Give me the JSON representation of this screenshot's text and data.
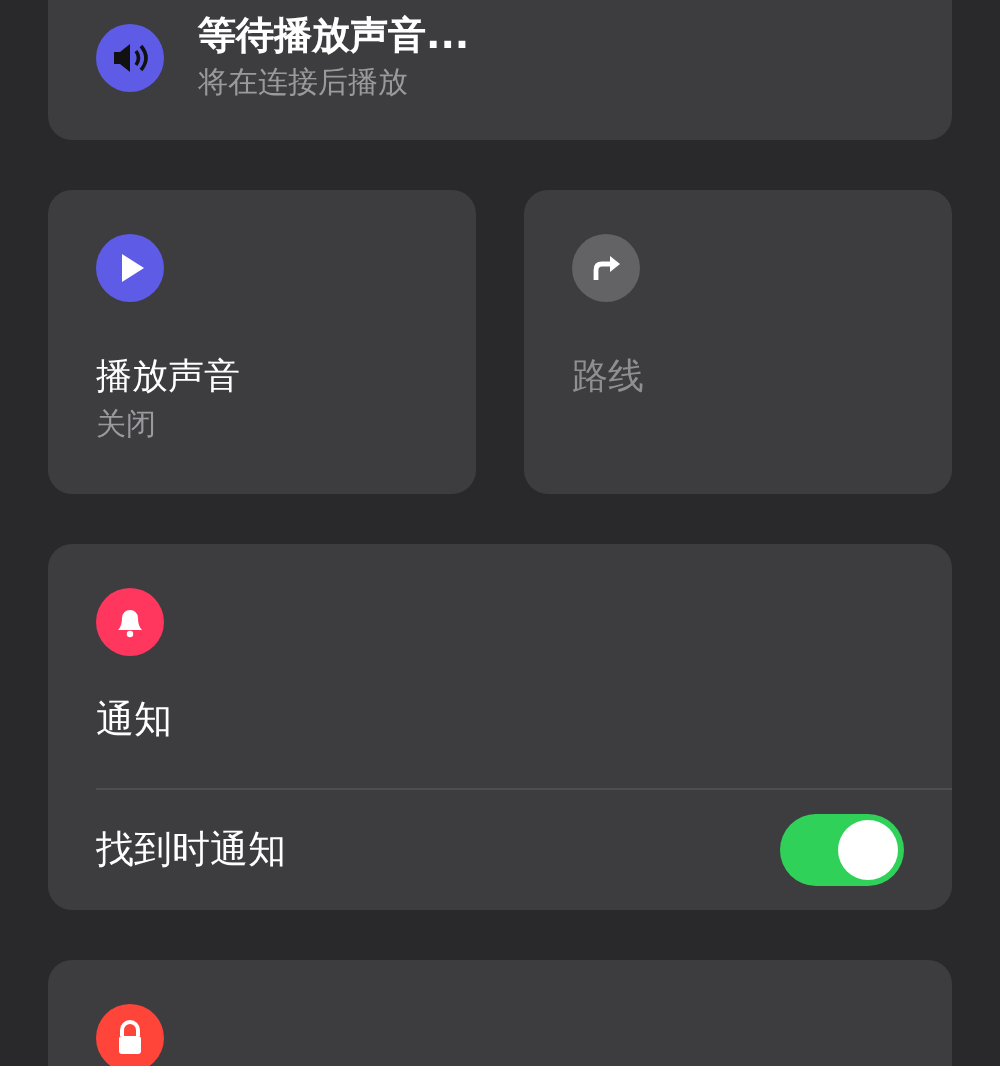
{
  "pending_sound": {
    "title": "等待播放声音...",
    "subtitle": "将在连接后播放"
  },
  "tiles": [
    {
      "kind": "play",
      "title": "播放声音",
      "subtitle": "关闭",
      "disabled": false
    },
    {
      "kind": "route",
      "title": "路线",
      "disabled": true
    }
  ],
  "notifications": {
    "title": "通知",
    "toggle": {
      "label": "找到时通知",
      "on": true
    }
  },
  "lock_card": {
    "kind": "lock"
  }
}
